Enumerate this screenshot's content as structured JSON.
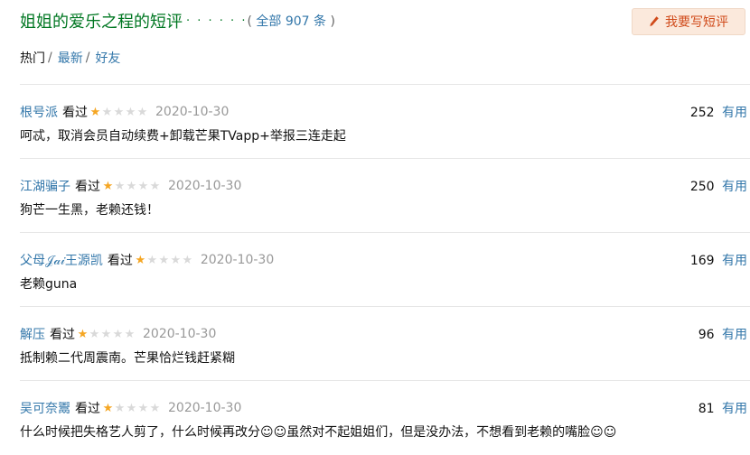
{
  "header": {
    "title": "姐姐的爱乐之程的短评",
    "dots": "· · · · · ·",
    "count_open": "(",
    "count_link": "全部 907 条",
    "count_close": ")"
  },
  "write_button": {
    "icon": "pencil-icon",
    "label": "我要写短评"
  },
  "sort_nav": {
    "items": [
      {
        "label": "热门",
        "sep": "/"
      },
      {
        "label": "最新",
        "sep": "/"
      },
      {
        "label": "好友",
        "sep": ""
      }
    ]
  },
  "colors": {
    "title_green": "#007722",
    "link_blue": "#3377aa",
    "star_on": "#f5a623",
    "star_off": "#d9d9d9",
    "button_bg": "#fbe9dc",
    "button_text": "#d04a1a"
  },
  "comments": [
    {
      "user": "根号派",
      "status": "看过",
      "rating": 1,
      "rating_max": 5,
      "date": "2020-10-30",
      "votes": "252",
      "useful_label": "有用",
      "text": "呵忒，取消会员自动续费+卸载芒果TVapp+举报三连走起"
    },
    {
      "user": "江湖骗子",
      "status": "看过",
      "rating": 1,
      "rating_max": 5,
      "date": "2020-10-30",
      "votes": "250",
      "useful_label": "有用",
      "text": "狗芒一生黑，老赖还钱！"
    },
    {
      "user": "父母𝒥𝒶𝒾王源凯",
      "status": "看过",
      "rating": 1,
      "rating_max": 5,
      "date": "2020-10-30",
      "votes": "169",
      "useful_label": "有用",
      "text": "老赖guna"
    },
    {
      "user": "解压",
      "status": "看过",
      "rating": 1,
      "rating_max": 5,
      "date": "2020-10-30",
      "votes": "96",
      "useful_label": "有用",
      "text": "抵制赖二代周震南。芒果恰烂钱赶紧糊"
    },
    {
      "user": "吴可奈鬻",
      "status": "看过",
      "rating": 1,
      "rating_max": 5,
      "date": "2020-10-30",
      "votes": "81",
      "useful_label": "有用",
      "text": "什么时候把失格艺人剪了，什么时候再改分☺☺虽然对不起姐姐们，但是没办法，不想看到老赖的嘴脸☺☺"
    }
  ]
}
